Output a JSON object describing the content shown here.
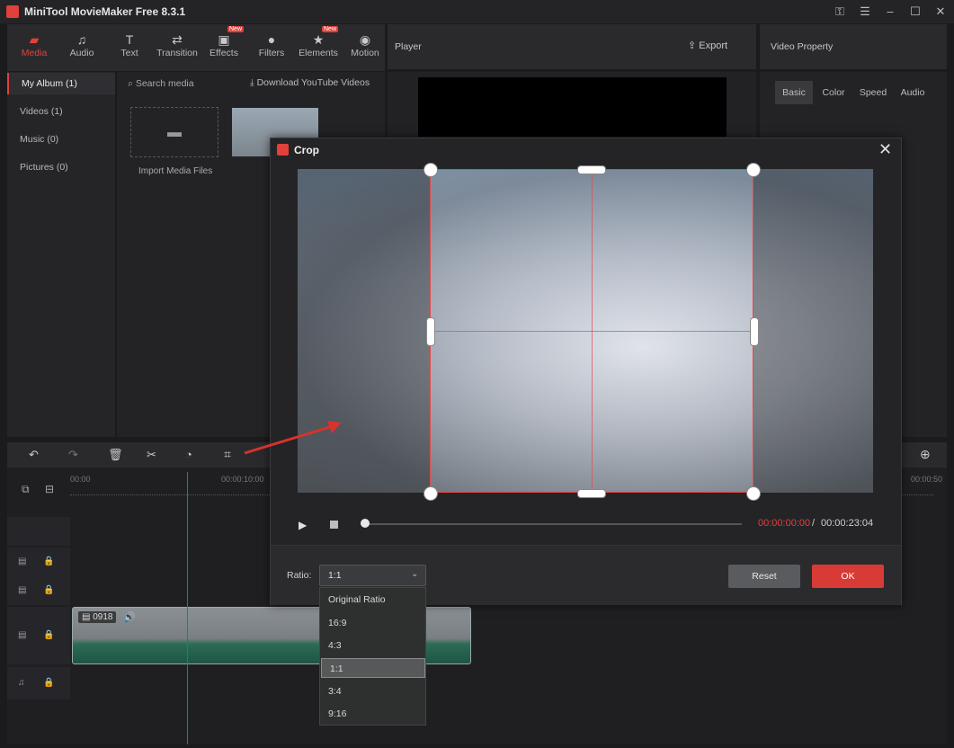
{
  "app": {
    "title": "MiniTool MovieMaker Free 8.3.1"
  },
  "toolbar": {
    "items": [
      {
        "label": "Media",
        "icon": "folder-icon"
      },
      {
        "label": "Audio",
        "icon": "music-note-icon"
      },
      {
        "label": "Text",
        "icon": "text-icon"
      },
      {
        "label": "Transition",
        "icon": "transition-icon"
      },
      {
        "label": "Effects",
        "icon": "effects-icon",
        "badge": "New"
      },
      {
        "label": "Filters",
        "icon": "filters-icon"
      },
      {
        "label": "Elements",
        "icon": "elements-icon",
        "badge": "New"
      },
      {
        "label": "Motion",
        "icon": "motion-icon"
      }
    ]
  },
  "player": {
    "title": "Player",
    "export_label": "Export"
  },
  "property": {
    "title": "Video Property",
    "tabs": [
      "Basic",
      "Color",
      "Speed",
      "Audio"
    ]
  },
  "sidebar": {
    "items": [
      "My Album (1)",
      "Videos (1)",
      "Music (0)",
      "Pictures (0)"
    ]
  },
  "media": {
    "search_placeholder": "Search media",
    "download_label": "Download YouTube Videos",
    "import_label": "Import Media Files"
  },
  "timeline": {
    "time_labels": [
      "00:00",
      "00:00:10:00",
      "00:00:50"
    ],
    "clip_label": "0918"
  },
  "crop": {
    "title": "Crop",
    "time_current": "00:00:00:00",
    "time_separator": "/",
    "time_total": "00:00:23:04",
    "ratio_label": "Ratio:",
    "ratio_value": "1:1",
    "ratio_options": [
      "Original Ratio",
      "16:9",
      "4:3",
      "1:1",
      "3:4",
      "9:16"
    ],
    "reset_label": "Reset",
    "ok_label": "OK"
  },
  "colors": {
    "accent": "#e0413a",
    "panel": "#2a2a2d",
    "background": "#1b1b1d"
  }
}
